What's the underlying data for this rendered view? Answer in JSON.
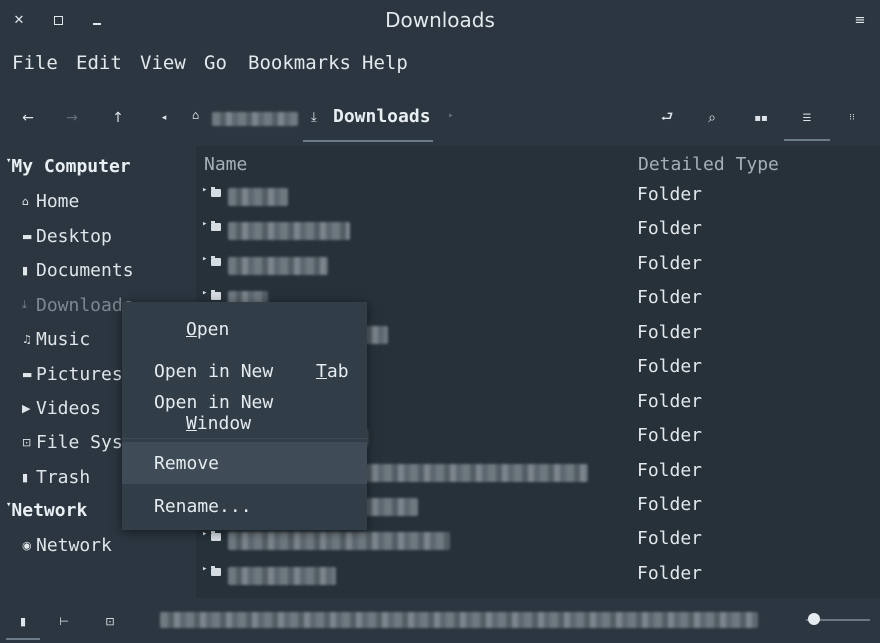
{
  "window": {
    "title": "Downloads"
  },
  "titlebar_icons": {
    "close": "close-icon",
    "maximize": "maximize-icon",
    "minimize": "minimize-icon",
    "menu": "hamburger-menu-icon"
  },
  "menubar": [
    "File",
    "Edit",
    "View",
    "Go",
    "Bookmarks",
    "Help"
  ],
  "toolbar": {
    "buttons": [
      "back-arrow-icon",
      "forward-arrow-icon",
      "up-arrow-icon",
      "breadcrumb-left-icon"
    ],
    "right_buttons": [
      "toggle-location-icon",
      "search-icon",
      "icon-view-icon",
      "list-view-icon",
      "compact-view-icon"
    ],
    "current_location": "Downloads"
  },
  "sidebar": {
    "sections": [
      {
        "title": "My Computer",
        "items": [
          {
            "label": "Home",
            "icon": "home-icon"
          },
          {
            "label": "Desktop",
            "icon": "desktop-icon"
          },
          {
            "label": "Documents",
            "icon": "documents-icon"
          },
          {
            "label": "Downloads",
            "icon": "downloads-icon"
          },
          {
            "label": "Music",
            "icon": "music-icon"
          },
          {
            "label": "Pictures",
            "icon": "pictures-icon"
          },
          {
            "label": "Videos",
            "icon": "videos-icon"
          },
          {
            "label": "File System",
            "icon": "drive-icon"
          },
          {
            "label": "Trash",
            "icon": "trash-icon"
          }
        ]
      },
      {
        "title": "Network",
        "items": [
          {
            "label": "Network",
            "icon": "network-icon"
          }
        ]
      }
    ]
  },
  "columns": {
    "name": "Name",
    "type": "Detailed Type"
  },
  "files": [
    {
      "type": "Folder"
    },
    {
      "type": "Folder"
    },
    {
      "type": "Folder"
    },
    {
      "type": "Folder"
    },
    {
      "type": "Folder"
    },
    {
      "type": "Folder"
    },
    {
      "type": "Folder"
    },
    {
      "type": "Folder"
    },
    {
      "type": "Folder"
    },
    {
      "type": "Folder"
    },
    {
      "type": "Folder"
    },
    {
      "type": "Folder"
    }
  ],
  "context_menu": {
    "items": [
      "Open",
      "Open in New Tab",
      "Open in New Window",
      "Remove",
      "Rename..."
    ],
    "highlighted": "Remove"
  },
  "statusbar": {
    "buttons": [
      "places-icon",
      "tree-icon",
      "hide-sidebar-icon"
    ],
    "zoom_icon": "zoom-slider-icon"
  },
  "colors": {
    "background": "#2b3640",
    "content": "#26313a",
    "menu": "#313d47",
    "highlight": "#3f4c57",
    "text": "#e3e8ec"
  }
}
